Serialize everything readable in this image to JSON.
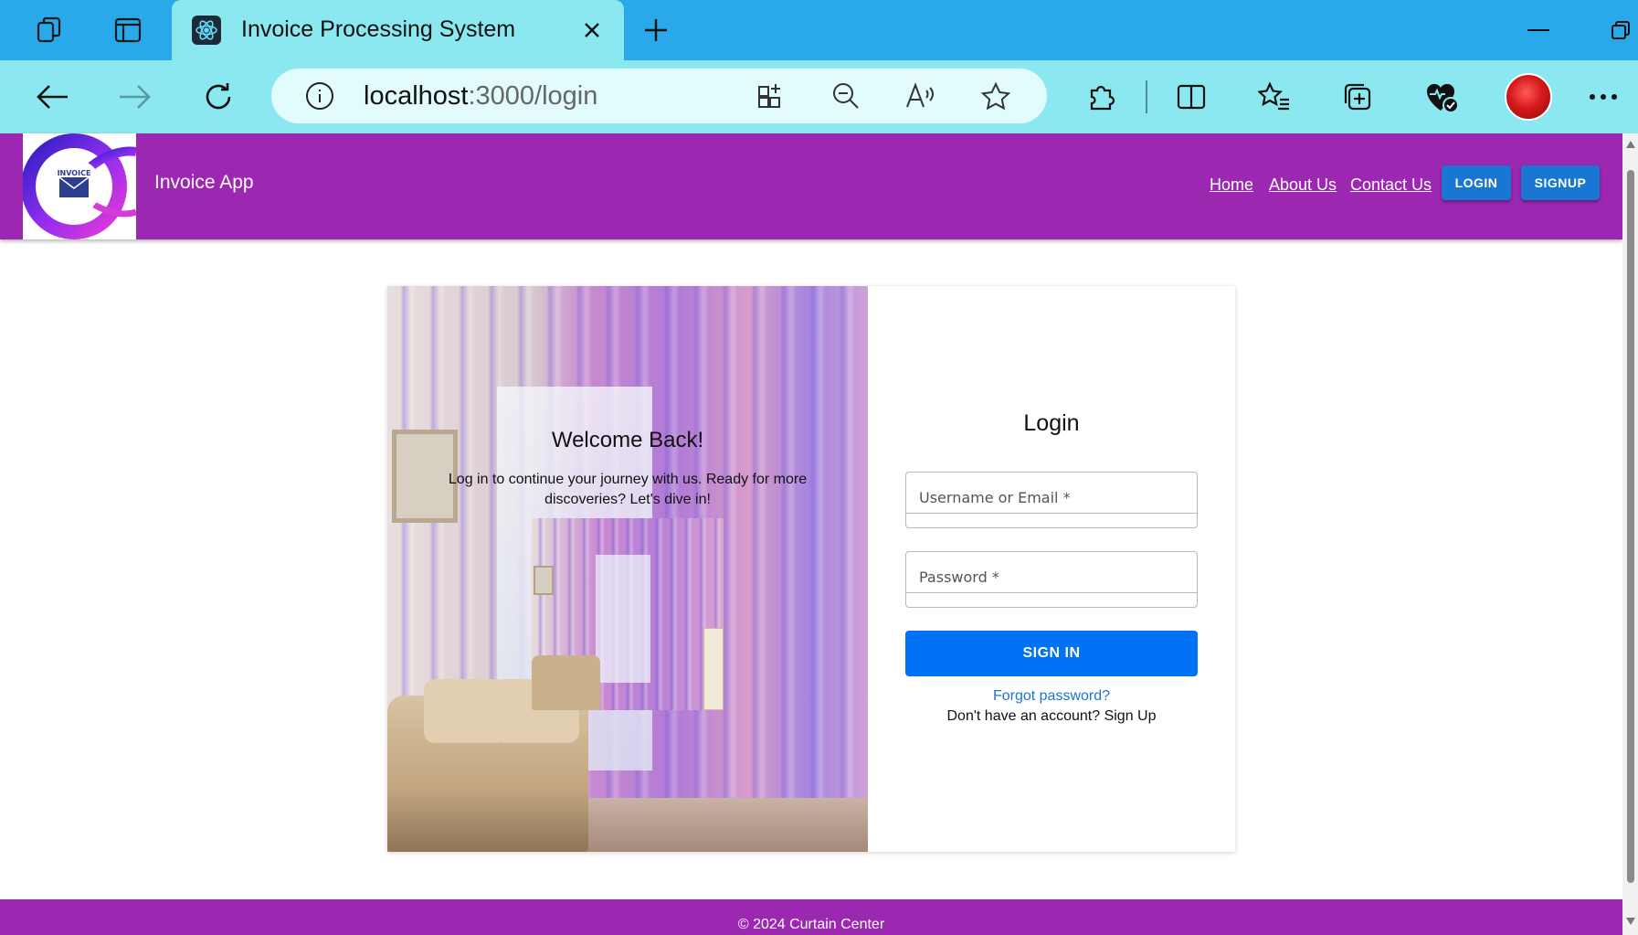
{
  "browser": {
    "tab_title": "Invoice Processing System",
    "url_host": "localhost",
    "url_path": ":3000/login"
  },
  "navbar": {
    "app_name": "Invoice App",
    "links": [
      "Home",
      "About Us",
      "Contact Us"
    ],
    "login_label": "LOGIN",
    "signup_label": "SIGNUP",
    "logo_text": "INVOICE",
    "brand_color": "#9c27b0"
  },
  "hero": {
    "title": "Welcome Back!",
    "text": "Log in to continue your journey with us. Ready for more discoveries? Let's dive in!"
  },
  "login": {
    "title": "Login",
    "username_label": "Username or Email *",
    "password_label": "Password *",
    "submit_label": "SIGN IN",
    "forgot_label": "Forgot password?",
    "signup_prompt": "Don't have an account? Sign Up",
    "accent_color": "#0072f5"
  },
  "footer": {
    "text": "© 2024 Curtain Center"
  },
  "icons": [
    "workspaces-icon",
    "tab-actions-icon",
    "react-favicon-icon",
    "close-icon",
    "plus-icon",
    "minimize-icon",
    "restore-icon",
    "back-icon",
    "forward-icon",
    "refresh-icon",
    "info-icon",
    "app-install-icon",
    "zoom-out-icon",
    "read-aloud-icon",
    "favorite-star-icon",
    "extensions-icon",
    "split-screen-icon",
    "favorites-list-icon",
    "collections-icon",
    "browser-essentials-icon",
    "more-icon"
  ]
}
